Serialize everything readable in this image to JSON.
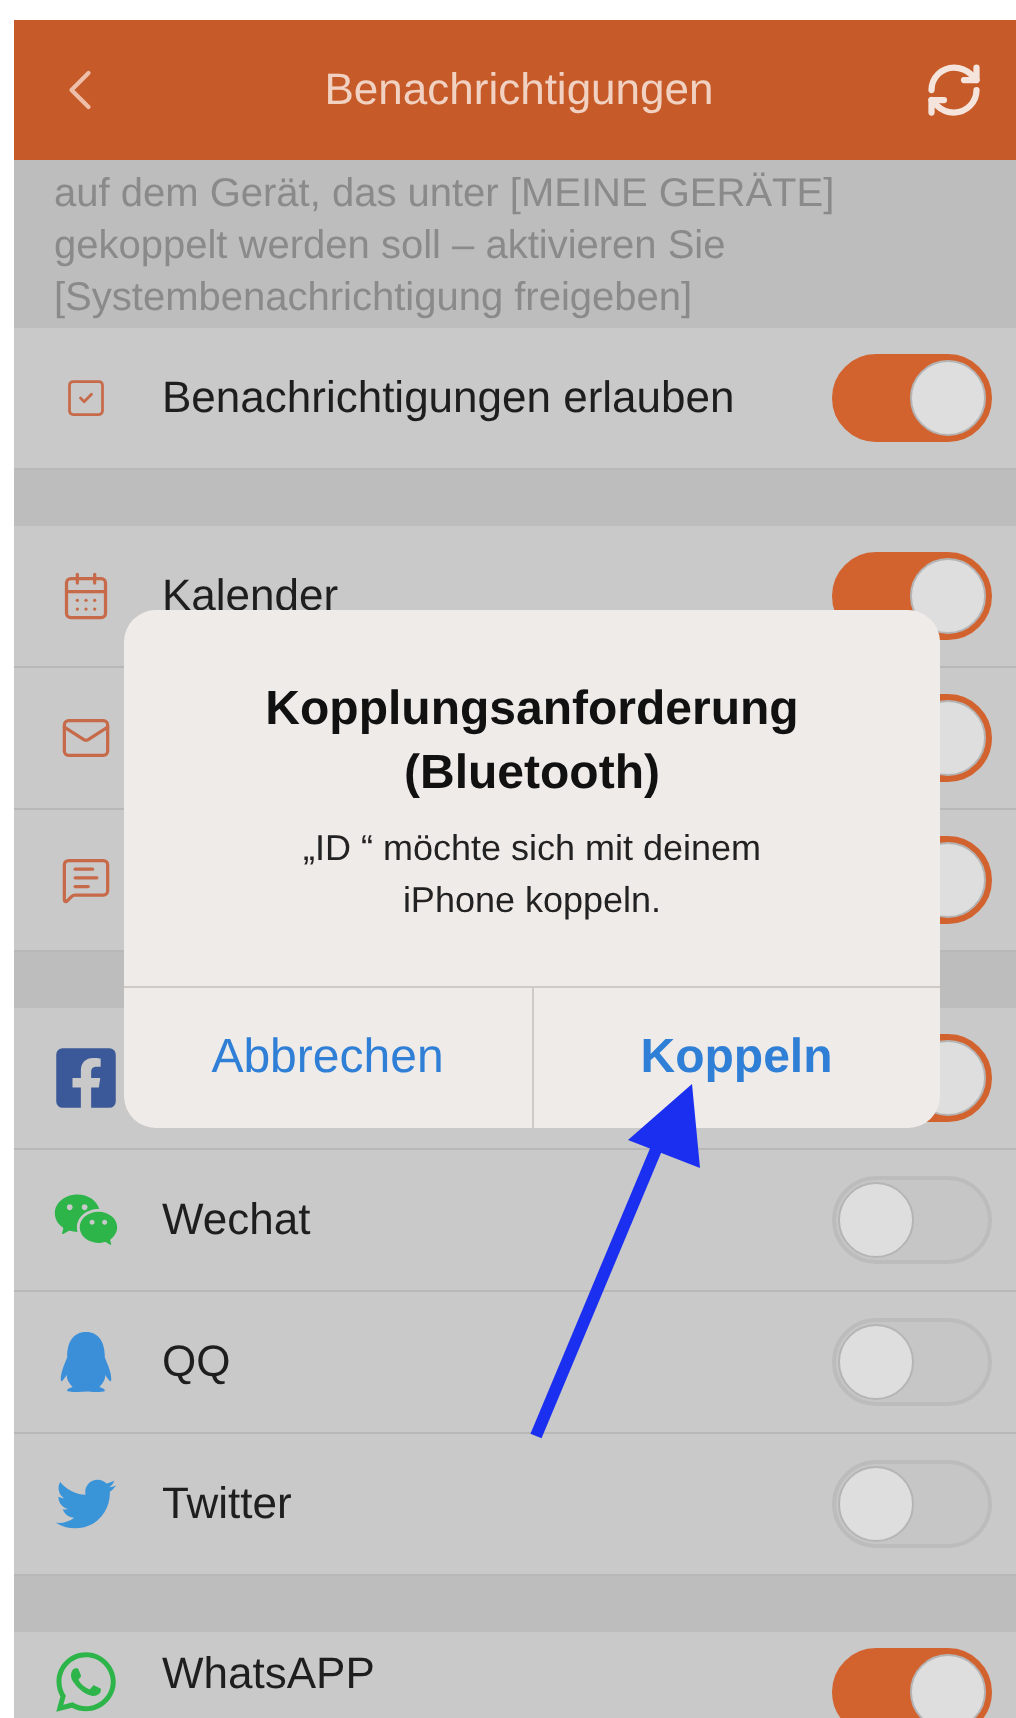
{
  "header": {
    "title": "Benachrichtigungen"
  },
  "description": "auf dem Gerät, das unter [MEINE GERÄTE] gekoppelt werden soll – aktivieren Sie [Systembenachrichtigung freigeben]",
  "sections": [
    {
      "rows": [
        {
          "kind": "checkbox",
          "label": "Benachrichtigungen erlauben",
          "on": true
        }
      ]
    },
    {
      "rows": [
        {
          "kind": "calendar",
          "label": "Kalender",
          "on": true
        },
        {
          "kind": "mail",
          "on": true
        },
        {
          "kind": "sms",
          "on": true
        }
      ]
    },
    {
      "rows": [
        {
          "kind": "facebook",
          "on": true
        },
        {
          "kind": "wechat",
          "label": "Wechat",
          "on": false
        },
        {
          "kind": "qq",
          "label": "QQ",
          "on": false
        },
        {
          "kind": "twitter",
          "label": "Twitter",
          "on": false
        }
      ]
    },
    {
      "rows": [
        {
          "kind": "whatsapp",
          "label": "WhatsAPP",
          "on": true
        }
      ]
    }
  ],
  "dialog": {
    "title": "Kopplungsanforderung (Bluetooth)",
    "message": "„ID “ möchte sich mit deinem iPhone koppeln.",
    "buttons": [
      {
        "label": "Abbrechen",
        "primary": false
      },
      {
        "label": "Koppeln",
        "primary": true
      }
    ]
  }
}
